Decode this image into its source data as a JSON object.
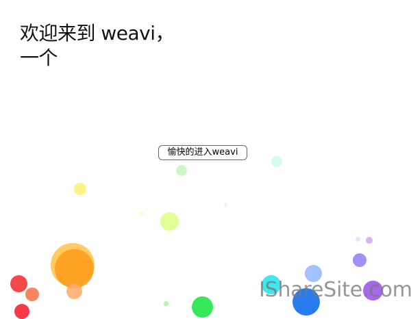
{
  "headline": {
    "line1": "欢迎来到 weavi，",
    "line2": "一个"
  },
  "enter_button": {
    "label": "愉快的进入weavi"
  },
  "watermark": {
    "text": "IShareSite.com"
  },
  "colors": {
    "background": "#ffffff",
    "text": "#111111",
    "button_border": "#666666",
    "watermark": "#787878"
  }
}
